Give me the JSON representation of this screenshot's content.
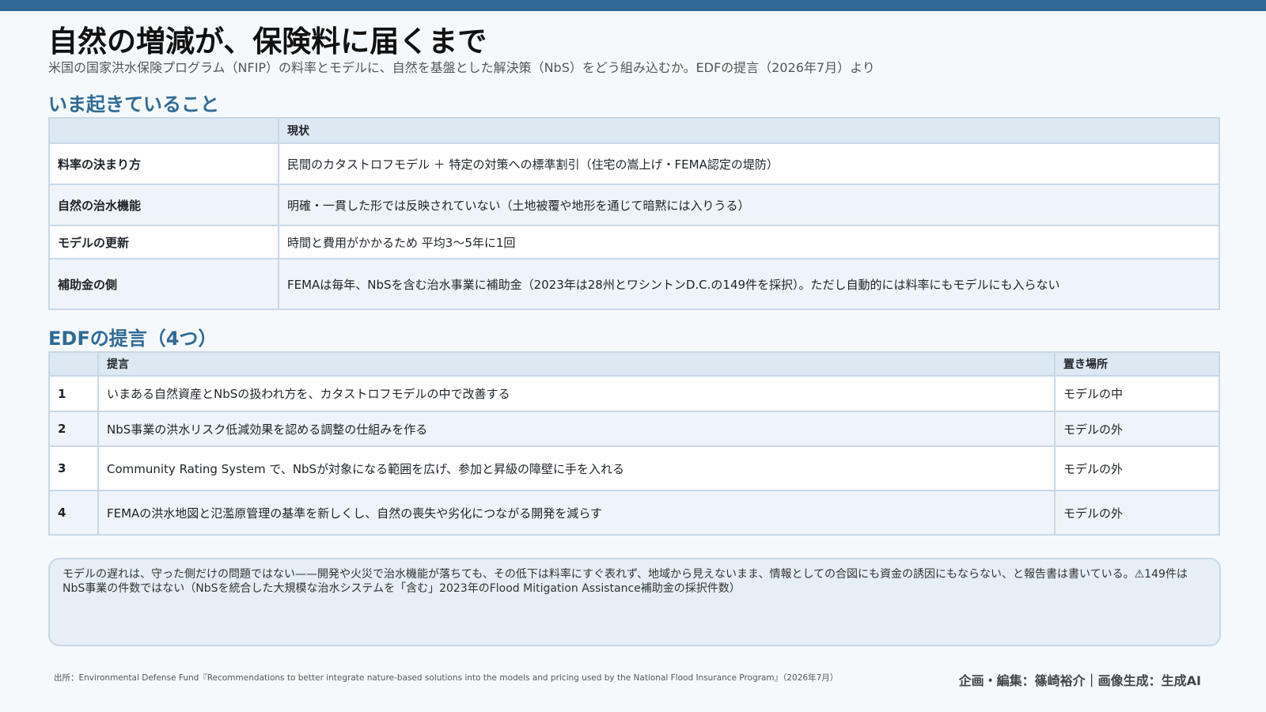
{
  "header": {
    "title": "自然の増減が、保険料に届くまで",
    "subtitle": "米国の国家洪水保険プログラム（NFIP）の料率とモデルに、自然を基盤とした解決策（NbS）をどう組み込むか。EDFの提言（2026年7月）より"
  },
  "colors": {
    "accent": "#2f6a96",
    "header_fill": "#dce8f2",
    "border": "#c9d8e6"
  },
  "section1": {
    "heading": "いま起きていること",
    "header_blank": "",
    "column_label": "現状",
    "rows": [
      {
        "label": "料率の決まり方",
        "value": "民間のカタストロフモデル ＋ 特定の対策への標準割引（住宅の嵩上げ・FEMA認定の堤防）"
      },
      {
        "label": "自然の治水機能",
        "value": "明確・一貫した形では反映されていない（土地被覆や地形を通じて暗黙には入りうる）"
      },
      {
        "label": "モデルの更新",
        "value": "時間と費用がかかるため 平均3〜5年に1回"
      },
      {
        "label": "補助金の側",
        "value": "FEMAは毎年、NbSを含む治水事業に補助金（2023年は28州とワシントンD.C.の149件を採択）。ただし自動的には料率にもモデルにも入らない"
      }
    ]
  },
  "section2": {
    "heading": "EDFの提言（4つ）",
    "col_num": "",
    "col_proposal": "提言",
    "col_place": "置き場所",
    "rows": [
      {
        "num": "1",
        "proposal": "いまある自然資産とNbSの扱われ方を、カタストロフモデルの中で改善する",
        "place": "モデルの中"
      },
      {
        "num": "2",
        "proposal": "NbS事業の洪水リスク低減効果を認める調整の仕組みを作る",
        "place": "モデルの外"
      },
      {
        "num": "3",
        "proposal": "Community Rating System で、NbSが対象になる範囲を広げ、参加と昇級の障壁に手を入れる",
        "place": "モデルの外"
      },
      {
        "num": "4",
        "proposal": "FEMAの洪水地図と氾濫原管理の基準を新しくし、自然の喪失や劣化につながる開発を減らす",
        "place": "モデルの外"
      }
    ]
  },
  "note": "モデルの遅れは、守った側だけの問題ではない——開発や火災で治水機能が落ちても、その低下は料率にすぐ表れず、地域から見えないまま、情報としての合図にも資金の誘因にもならない、と報告書は書いている。⚠149件はNbS事業の件数ではない（NbSを統合した大規模な治水システムを「含む」2023年のFlood Mitigation Assistance補助金の採択件数）",
  "footer": {
    "source": "出所：Environmental Defense Fund『Recommendations to better integrate nature-based solutions into the models and pricing used by the National Flood Insurance Program』（2026年7月）",
    "credit": "企画・編集：篠崎裕介｜画像生成：生成AI"
  }
}
